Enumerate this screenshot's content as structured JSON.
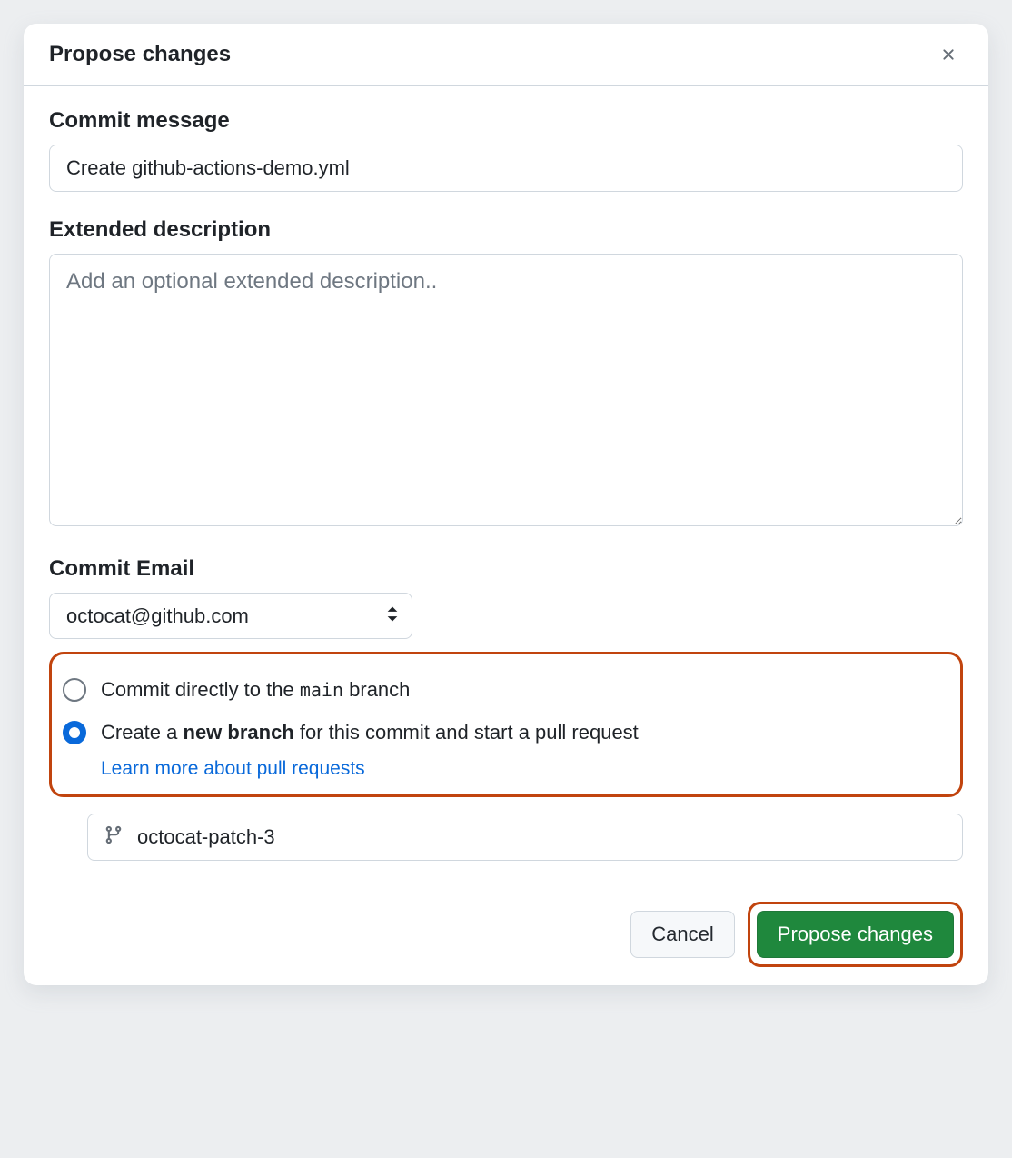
{
  "dialog": {
    "title": "Propose changes"
  },
  "form": {
    "commit_message_label": "Commit message",
    "commit_message_value": "Create github-actions-demo.yml",
    "extended_description_label": "Extended description",
    "extended_description_placeholder": "Add an optional extended description..",
    "commit_email_label": "Commit Email",
    "commit_email_value": "octocat@github.com",
    "radio_direct_prefix": "Commit directly to the ",
    "radio_direct_branch": "main",
    "radio_direct_suffix": " branch",
    "radio_new_prefix": "Create a ",
    "radio_new_bold": "new branch",
    "radio_new_suffix": " for this commit and start a pull request",
    "learn_more": "Learn more about pull requests",
    "branch_name_value": "octocat-patch-3"
  },
  "footer": {
    "cancel": "Cancel",
    "propose": "Propose changes"
  }
}
